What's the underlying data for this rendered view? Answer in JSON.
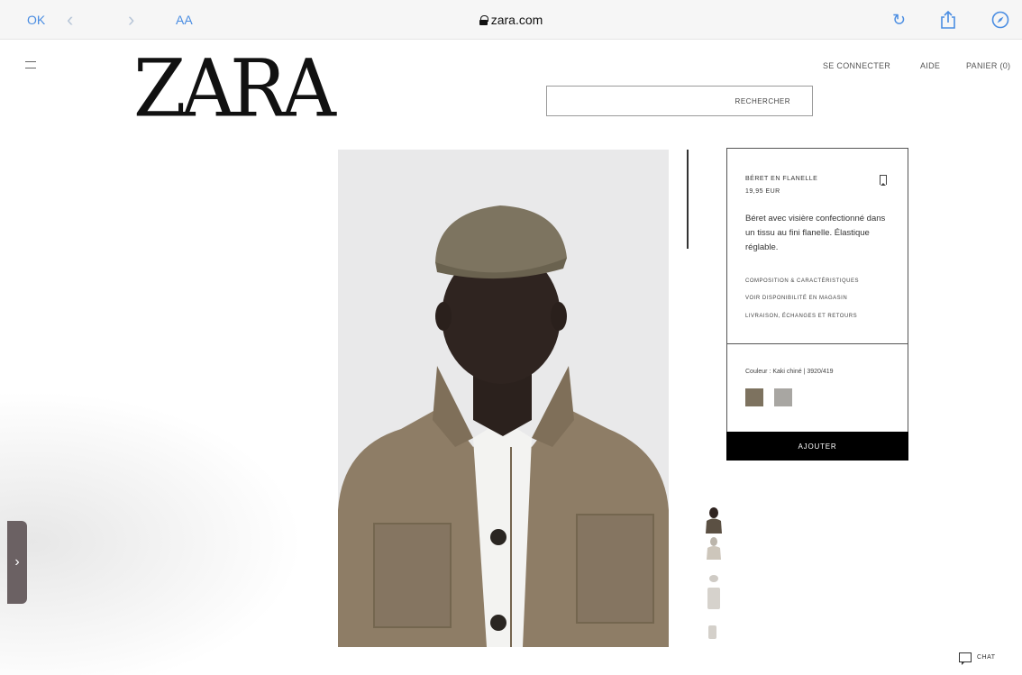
{
  "browser": {
    "ok_label": "OK",
    "back_glyph": "‹",
    "forward_glyph": "›",
    "text_size_label": "AA",
    "url": "zara.com",
    "reload_glyph": "↻",
    "share_glyph": "⍐",
    "compass_glyph": "⊘"
  },
  "header": {
    "logo": "ZARA",
    "login_label": "SE CONNECTER",
    "help_label": "AIDE",
    "cart_label": "PANIER (0)",
    "search_label": "RECHERCHER"
  },
  "product": {
    "name": "BÉRET EN FLANELLE",
    "price": "19,95 EUR",
    "description": "Béret avec visière confectionné dans un tissu au fini flanelle. Élastique réglable.",
    "links": [
      "COMPOSITION & CARACTÉRISTIQUES",
      "VOIR DISPONIBILITÉ EN MAGASIN",
      "LIVRAISON, ÉCHANGES ET RETOURS"
    ],
    "color_label": "Couleur : Kaki chiné | 3920/419",
    "swatch_colors": [
      "#7d725f",
      "#a8a6a2"
    ],
    "add_label": "AJOUTER",
    "thumbnail_count": 4
  },
  "side_handle": {
    "glyph": "›"
  },
  "chat": {
    "label": "CHAT"
  }
}
